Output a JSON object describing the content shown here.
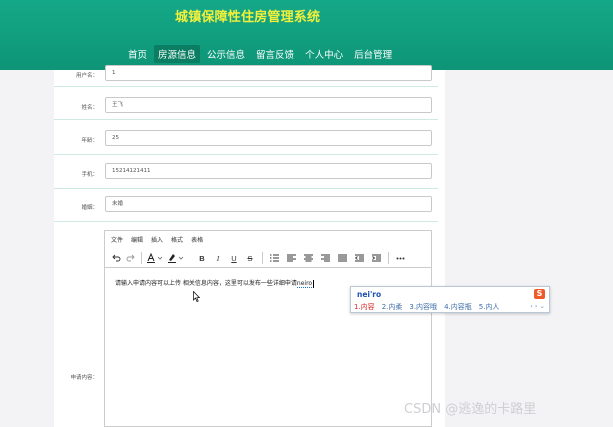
{
  "header": {
    "site_title": "城镇保障性住房管理系统",
    "nav": [
      {
        "label": "首页",
        "active": false
      },
      {
        "label": "房源信息",
        "active": true
      },
      {
        "label": "公示信息",
        "active": false
      },
      {
        "label": "留言反馈",
        "active": false
      },
      {
        "label": "个人中心",
        "active": false
      },
      {
        "label": "后台管理",
        "active": false
      }
    ]
  },
  "form": {
    "fields": [
      {
        "label": "用户名：",
        "value": "1"
      },
      {
        "label": "姓名：",
        "value": "王飞"
      },
      {
        "label": "年龄：",
        "value": "25"
      },
      {
        "label": "手机：",
        "value": "15214121411"
      },
      {
        "label": "婚姻：",
        "value": "未婚"
      }
    ],
    "content_label": "申请内容："
  },
  "editor": {
    "menus": [
      "文件",
      "编辑",
      "插入",
      "格式",
      "表格"
    ],
    "toolbar_icons": [
      "undo-icon",
      "redo-icon",
      "font-color-icon",
      "highlight-color-icon",
      "bold-icon",
      "italic-icon",
      "underline-icon",
      "strikethrough-icon",
      "ordered-list-icon",
      "align-left-icon",
      "align-center-icon",
      "align-right-icon",
      "align-justify-icon",
      "outdent-icon",
      "indent-icon",
      "more-icon"
    ],
    "body_text": "请输入申请内容可以上传 相关信息内容，这里可以发布一些详细申请",
    "typed_text": "neiro"
  },
  "ime": {
    "input": "nei'ro",
    "logo": "S",
    "candidates": [
      "1.内容",
      "2.内柔",
      "3.内容哦",
      "4.内容瓶",
      "5.内人"
    ],
    "arrows": "‹ › ⌄"
  },
  "watermark": "CSDN @逃逸的卡路里"
}
